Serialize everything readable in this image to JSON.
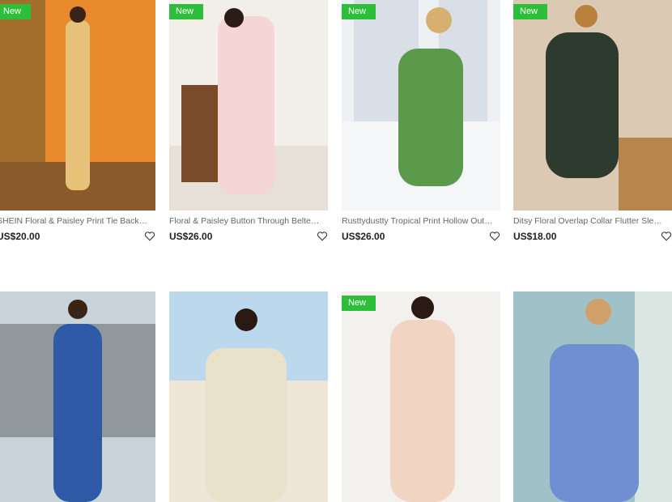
{
  "badges": {
    "new": "New"
  },
  "products": [
    {
      "title": "SHEIN Floral & Paisley Print Tie Backless Cami Jumpsuit",
      "price": "US$20.00",
      "badge": true,
      "bg": "#e8802a"
    },
    {
      "title": "Floral & Paisley Button Through Belted Shirt Dress",
      "price": "US$26.00",
      "badge": true,
      "bg": "#f4f1ec"
    },
    {
      "title": "Rusttydustty Tropical Print Hollow Out Crisscross Dress",
      "price": "US$26.00",
      "badge": true,
      "bg": "#e9edf1"
    },
    {
      "title": "Ditsy Floral Overlap Collar Flutter Sleeve Dress",
      "price": "US$18.00",
      "badge": true,
      "bg": "#d9c6b1"
    },
    {
      "title": "",
      "price": "",
      "badge": false,
      "bg": "#c9d6e0"
    },
    {
      "title": "",
      "price": "",
      "badge": false,
      "bg": "#bcd8ec"
    },
    {
      "title": "",
      "price": "",
      "badge": true,
      "bg": "#f3f1ee"
    },
    {
      "title": "",
      "price": "",
      "badge": false,
      "bg": "#9fc2c8"
    }
  ],
  "icons": {
    "wishlist": "heart-icon"
  },
  "colors": {
    "badge": "#2dbf3a",
    "price": "#222222",
    "title": "#666666"
  }
}
